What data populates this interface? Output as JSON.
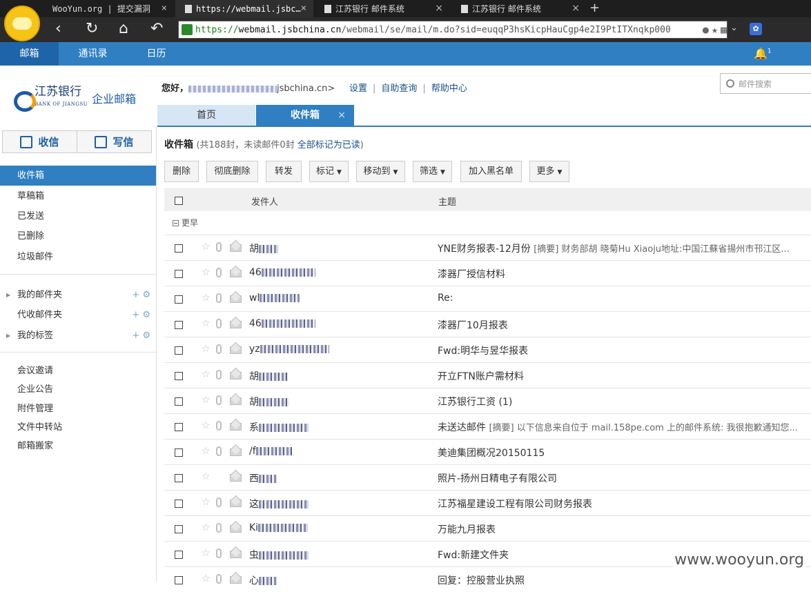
{
  "browser": {
    "tabs": [
      {
        "label": "WooYun.org | 提交漏洞"
      },
      {
        "label": "https://webmail.jsbc…",
        "active": true
      },
      {
        "label": "江苏银行 邮件系统"
      },
      {
        "label": "江苏银行 邮件系统"
      }
    ],
    "url_scheme": "https://",
    "url_host": "webmail.jsbchina.cn",
    "url_path": "/webmail/se/mail/m.do?sid=euqqP3hsKicpHauCgp4e2I9PtITXnqkp000"
  },
  "topnav": {
    "items": [
      "邮箱",
      "通讯录",
      "日历"
    ],
    "notification_count": "1"
  },
  "header": {
    "brand_cn": "江苏银行",
    "brand_en": "BANK OF JIANGSU",
    "product": "企业邮箱",
    "greeting": "您好，",
    "email_suffix": "jsbchina.cn>",
    "links": [
      "设置",
      "自助查询",
      "帮助中心"
    ],
    "search_placeholder": "邮件搜索"
  },
  "content_tabs": {
    "home": "首页",
    "inbox": "收件箱",
    "close": "×"
  },
  "sidebar": {
    "receive": "收信",
    "compose": "写信",
    "folders": [
      "收件箱",
      "草稿箱",
      "已发送",
      "已删除",
      "垃圾邮件"
    ],
    "custom": [
      "我的邮件夹",
      "代收邮件夹",
      "我的标签"
    ],
    "tools": [
      "会议邀请",
      "企业公告",
      "附件管理",
      "文件中转站",
      "邮箱搬家"
    ]
  },
  "main": {
    "title": "收件箱",
    "meta_prefix": "(共188封，未读邮件0封 ",
    "mark_all": "全部标记为已读",
    "meta_suffix": ")",
    "toolbar": [
      "删除",
      "彻底删除",
      "转发",
      "标记",
      "移动到",
      "筛选",
      "加入黑名单",
      "更多"
    ],
    "col_from": "发件人",
    "col_subject": "主题",
    "group_label": "更早",
    "rows": [
      {
        "from": "胡",
        "subject": "YNE财务报表-12月份",
        "summary": "[摘要] 财务部胡 晓菊Hu Xiaoju地址:中国江蘇省揚州市邗江区...",
        "clip": true
      },
      {
        "from": "46",
        "subject": "漆器厂授信材料",
        "summary": "",
        "clip": true
      },
      {
        "from": "wl",
        "subject": "Re:",
        "summary": "",
        "clip": true
      },
      {
        "from": "46",
        "subject": "漆器厂10月报表",
        "summary": "",
        "clip": true
      },
      {
        "from": "yz",
        "subject": "Fwd:明华与昱华报表",
        "summary": "",
        "clip": true
      },
      {
        "from": "胡",
        "subject": "开立FTN账户需材料",
        "summary": "",
        "clip": true
      },
      {
        "from": "胡",
        "subject": "江苏银行工资 (1)",
        "summary": "",
        "clip": true
      },
      {
        "from": "系",
        "subject": "未送达邮件",
        "summary": "[摘要] 以下信息来自位于 mail.158pe.com 上的邮件系统: 我很抱歉通知您...",
        "clip": true
      },
      {
        "from": "/f",
        "subject": "美迪集团概况20150115",
        "summary": "",
        "clip": true
      },
      {
        "from": "西",
        "subject": "照片-扬州日精电子有限公司",
        "summary": "",
        "clip": false
      },
      {
        "from": "这",
        "subject": "江苏福星建设工程有限公司财务报表",
        "summary": "",
        "clip": true
      },
      {
        "from": "Ki",
        "subject": "万能九月报表",
        "summary": "",
        "clip": true
      },
      {
        "from": "虫",
        "subject": "Fwd:新建文件夹",
        "summary": "",
        "clip": true
      },
      {
        "from": "心",
        "subject": "回复：控股营业执照",
        "summary": "",
        "clip": true
      }
    ]
  },
  "watermark": "www.wooyun.org",
  "colors": {
    "accent": "#2f7fc2",
    "accent_dark": "#1d65a8"
  }
}
